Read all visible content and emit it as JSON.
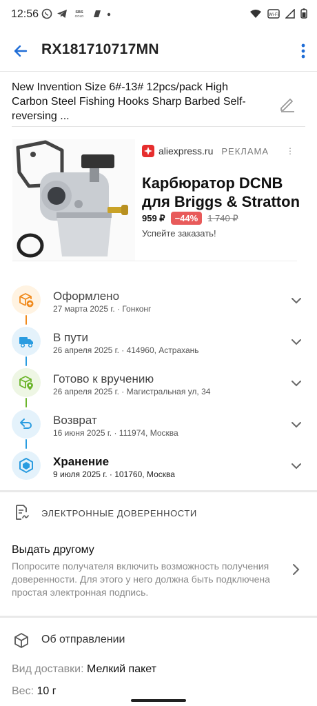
{
  "status_bar": {
    "time": "12:56",
    "left_icons": [
      "whatsapp-icon",
      "telegram-icon",
      "sbs-icon",
      "app-icon",
      "dot-icon"
    ],
    "sbs_text": "SBS GOLD",
    "volte_text": "VoWiFi"
  },
  "header": {
    "title": "RX181710717MN"
  },
  "product": {
    "name": "New Invention Size 6#-13# 12pcs/pack High Carbon Steel Fishing Hooks Sharp Barbed Self-reversing ..."
  },
  "ad": {
    "source": "aliexpress.ru",
    "tag": "РЕКЛАМА",
    "title": "Карбюратор DCNB для Briggs & Stratton",
    "price_now": "959 ₽",
    "discount": "−44%",
    "price_old": "1 740 ₽",
    "cta": "Успейте заказать!"
  },
  "tracking": [
    {
      "name": "Оформлено",
      "detail": "27 марта 2025 г. · Гонконг",
      "icon": "package-add-icon",
      "color": "#f08a1c",
      "bg": "#fff3e2"
    },
    {
      "name": "В пути",
      "detail": "26 апреля 2025 г. · 414960, Астрахань",
      "icon": "truck-icon",
      "color": "#2a9ce0",
      "bg": "#e4f2fb"
    },
    {
      "name": "Готово к вручению",
      "detail": "26 апреля 2025 г. · Магистральная ул, 34",
      "icon": "package-location-icon",
      "color": "#6cb52c",
      "bg": "#eef6e4"
    },
    {
      "name": "Возврат",
      "detail": "16 июня 2025 г. · 111974, Москва",
      "icon": "return-arrow-icon",
      "color": "#2a9ce0",
      "bg": "#e4f2fb"
    },
    {
      "name": "Хранение",
      "detail": "9 июля 2025 г. · 101760, Москва",
      "icon": "storage-box-icon",
      "color": "#2a9ce0",
      "bg": "#e4f2fb"
    }
  ],
  "connector_colors": [
    "#f08a1c",
    "#2a9ce0",
    "#6cb52c",
    "#2a9ce0"
  ],
  "power_of_attorney": {
    "heading": "ЭЛЕКТРОННЫЕ ДОВЕРЕННОСТИ",
    "action_title": "Выдать другому",
    "action_description": "Попросите получателя включить возможность получения доверенности. Для этого у него должна быть подключена простая электронная подпись."
  },
  "shipment": {
    "heading": "Об отправлении",
    "delivery_label": "Вид доставки:",
    "delivery_value": "Мелкий пакет",
    "weight_label": "Вес:",
    "weight_value": "10 г"
  },
  "colors": {
    "accent": "#1f6dd6"
  }
}
